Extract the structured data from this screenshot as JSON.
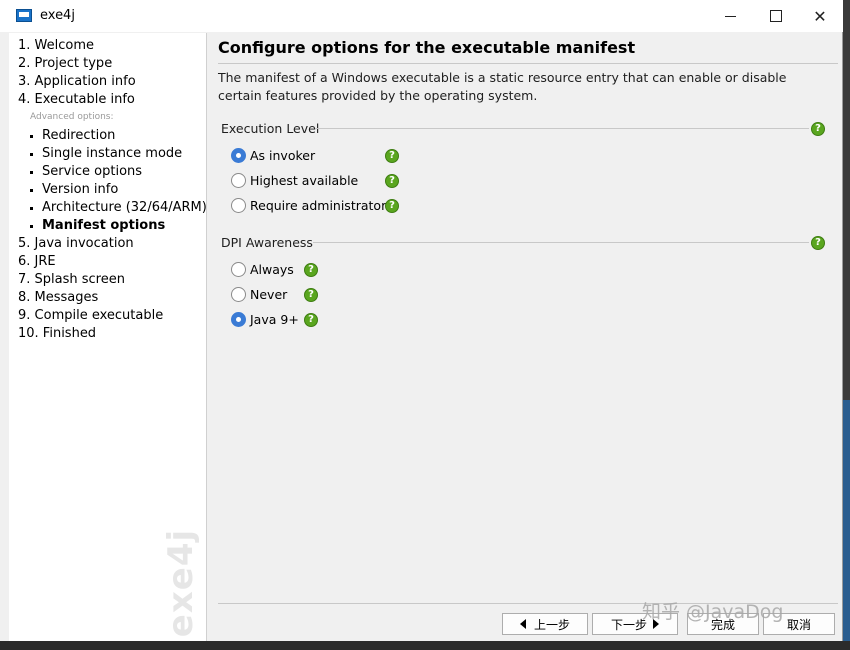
{
  "window": {
    "title": "exe4j"
  },
  "sidebar": {
    "steps": [
      {
        "label": "1. Welcome"
      },
      {
        "label": "2. Project type"
      },
      {
        "label": "3. Application info"
      },
      {
        "label": "4. Executable info"
      }
    ],
    "advanced_label": "Advanced options:",
    "sub_steps": [
      {
        "label": "Redirection"
      },
      {
        "label": "Single instance mode"
      },
      {
        "label": "Service options"
      },
      {
        "label": "Version info"
      },
      {
        "label": "Architecture (32/64/ARM)"
      },
      {
        "label": "Manifest options",
        "active": true
      }
    ],
    "later_steps": [
      {
        "label": "5. Java invocation"
      },
      {
        "label": "6. JRE"
      },
      {
        "label": "7. Splash screen"
      },
      {
        "label": "8. Messages"
      },
      {
        "label": "9. Compile executable"
      },
      {
        "label": "10. Finished"
      }
    ],
    "watermark": "exe4j"
  },
  "main": {
    "heading": "Configure options for the executable manifest",
    "description": "The manifest of a Windows executable is a static resource entry that can enable or disable certain features provided by the operating system.",
    "execution_level": {
      "label": "Execution Level",
      "options": [
        {
          "label": "As invoker",
          "checked": true
        },
        {
          "label": "Highest available",
          "checked": false
        },
        {
          "label": "Require administrator",
          "checked": false
        }
      ]
    },
    "dpi_awareness": {
      "label": "DPI Awareness",
      "options": [
        {
          "label": "Always",
          "checked": false
        },
        {
          "label": "Never",
          "checked": false
        },
        {
          "label": "Java 9+",
          "checked": true
        }
      ]
    },
    "help_glyph": "?"
  },
  "footer": {
    "back_label": "上一步",
    "next_label": "下一步",
    "finish_label": "完成",
    "cancel_label": "取消"
  },
  "overlay_watermark": "知乎 @JavaDog",
  "colors": {
    "help_green": "#5aa61f",
    "radio_blue": "#3a7bd5"
  }
}
